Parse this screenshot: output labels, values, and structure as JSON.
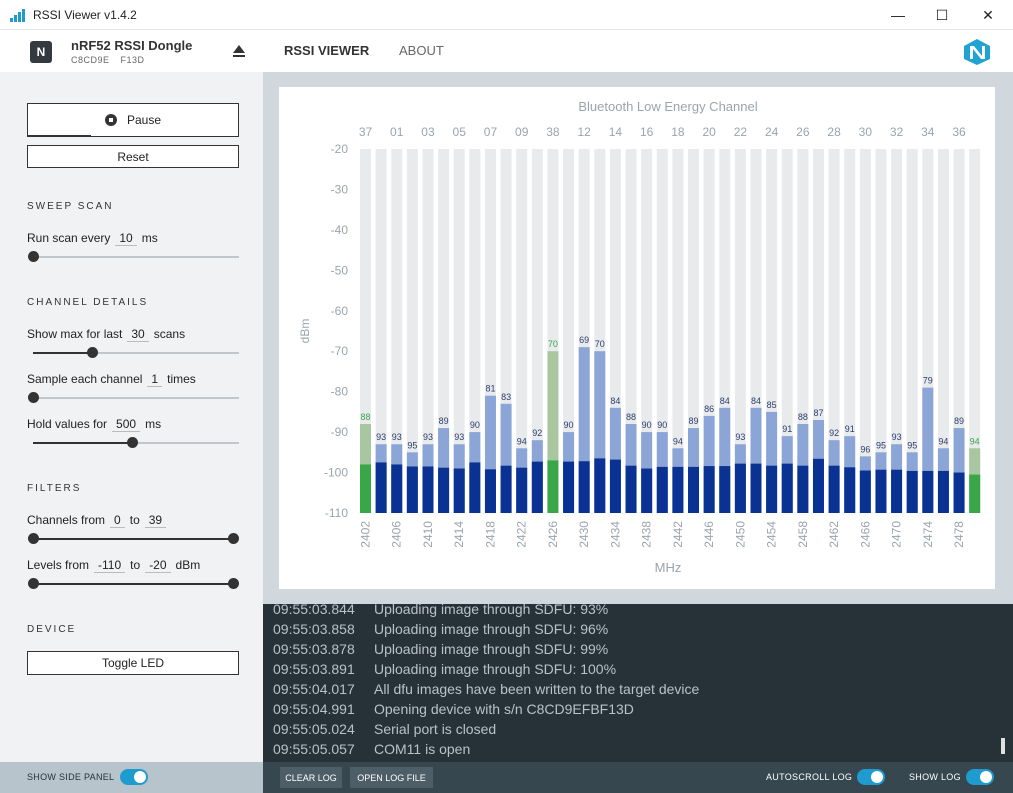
{
  "window": {
    "title": "RSSI Viewer v1.4.2",
    "minimize": "—",
    "maximize": "☐",
    "close": "✕"
  },
  "device": {
    "name": "nRF52 RSSI Dongle",
    "serial_a": "C8CD9E",
    "serial_b": "F13D",
    "chip_letter": "N"
  },
  "nav": {
    "tabs": [
      {
        "label": "RSSI VIEWER",
        "active": true
      },
      {
        "label": "ABOUT",
        "active": false
      }
    ]
  },
  "side": {
    "pause_label": "Pause",
    "reset_label": "Reset",
    "sweep_title": "SWEEP SCAN",
    "run_scan": {
      "prefix": "Run scan every",
      "value": "10",
      "unit": "ms",
      "level": 0.0
    },
    "channel_title": "CHANNEL DETAILS",
    "show_max": {
      "prefix": "Show max for last",
      "value": "30",
      "unit": "scans",
      "level": 0.3
    },
    "sample_each": {
      "prefix": "Sample each channel",
      "value": "1",
      "unit": "times",
      "level": 0.0
    },
    "hold_values": {
      "prefix": "Hold values for",
      "value": "500",
      "unit": "ms",
      "level": 0.47
    },
    "filters_title": "FILTERS",
    "channels_from": {
      "prefix": "Channels from",
      "from": "0",
      "to_word": "to",
      "to": "39"
    },
    "levels_from": {
      "prefix": "Levels from",
      "from": "-110",
      "to_word": "to",
      "to": "-20",
      "unit": "dBm"
    },
    "device_title": "DEVICE",
    "toggle_led_label": "Toggle LED"
  },
  "chart_data": {
    "type": "bar",
    "title": "Bluetooth Low Energy Channel",
    "xlabel": "MHz",
    "ylabel": "dBm",
    "ylim": [
      -110,
      -20
    ],
    "yticks": [
      "-20",
      "-30",
      "-40",
      "-50",
      "-60",
      "-70",
      "-80",
      "-90",
      "-100",
      "-110"
    ],
    "top_labels": [
      "37",
      "01",
      "03",
      "05",
      "07",
      "09",
      "38",
      "12",
      "14",
      "16",
      "18",
      "20",
      "22",
      "24",
      "26",
      "28",
      "30",
      "32",
      "34",
      "36"
    ],
    "bottom_labels": [
      "2402",
      "2406",
      "2410",
      "2414",
      "2418",
      "2422",
      "2426",
      "2430",
      "2434",
      "2438",
      "2442",
      "2446",
      "2450",
      "2454",
      "2458",
      "2462",
      "2466",
      "2470",
      "2474",
      "2478"
    ],
    "advertising_indices": [
      0,
      12,
      39
    ],
    "series": [
      {
        "name": "max",
        "values": [
          -88,
          -93,
          -93,
          -95,
          -93,
          -89,
          -93,
          -90,
          -81,
          -83,
          -94,
          -92,
          -70,
          -90,
          -69,
          -70,
          -84,
          -88,
          -90,
          -90,
          -94,
          -89,
          -86,
          -84,
          -93,
          -84,
          -85,
          -91,
          -88,
          -87,
          -92,
          -91,
          -96,
          -95,
          -93,
          -95,
          -79,
          -94,
          -89,
          -94
        ]
      },
      {
        "name": "current",
        "values": [
          -98,
          -97.5,
          -98,
          -98.5,
          -98.5,
          -98.8,
          -99,
          -97.5,
          -99.2,
          -98.3,
          -98.8,
          -97.3,
          -97,
          -97.3,
          -97.2,
          -96.5,
          -96.8,
          -98.3,
          -99,
          -98.6,
          -98.6,
          -98.6,
          -98.4,
          -98.4,
          -97.8,
          -97.8,
          -98.3,
          -97.8,
          -98.3,
          -96.6,
          -98.3,
          -98.7,
          -99.5,
          -99.3,
          -99.3,
          -99.6,
          -99.6,
          -99.6,
          -100,
          -100.5
        ]
      }
    ],
    "colors": {
      "max": "#8aa5d6",
      "current": "#0a3293",
      "max_adv": "#a8c7a0",
      "current_adv": "#3aa64a",
      "background_bar": "#e8eaec",
      "label": "#2c3e6b",
      "label_adv": "#3aa64a"
    }
  },
  "log": [
    {
      "time": "09:55:03.844",
      "msg": "Uploading image through SDFU: 93%"
    },
    {
      "time": "09:55:03.858",
      "msg": "Uploading image through SDFU: 96%"
    },
    {
      "time": "09:55:03.878",
      "msg": "Uploading image through SDFU: 99%"
    },
    {
      "time": "09:55:03.891",
      "msg": "Uploading image through SDFU: 100%"
    },
    {
      "time": "09:55:04.017",
      "msg": "All dfu images have been written to the target device"
    },
    {
      "time": "09:55:04.991",
      "msg": "Opening device with s/n C8CD9EFBF13D"
    },
    {
      "time": "09:55:05.024",
      "msg": "Serial port is closed"
    },
    {
      "time": "09:55:05.057",
      "msg": "COM11 is open"
    }
  ],
  "footer": {
    "show_side_panel": "SHOW SIDE PANEL",
    "clear_log": "CLEAR LOG",
    "open_log_file": "OPEN LOG FILE",
    "autoscroll_log": "AUTOSCROLL LOG",
    "show_log": "SHOW LOG"
  }
}
